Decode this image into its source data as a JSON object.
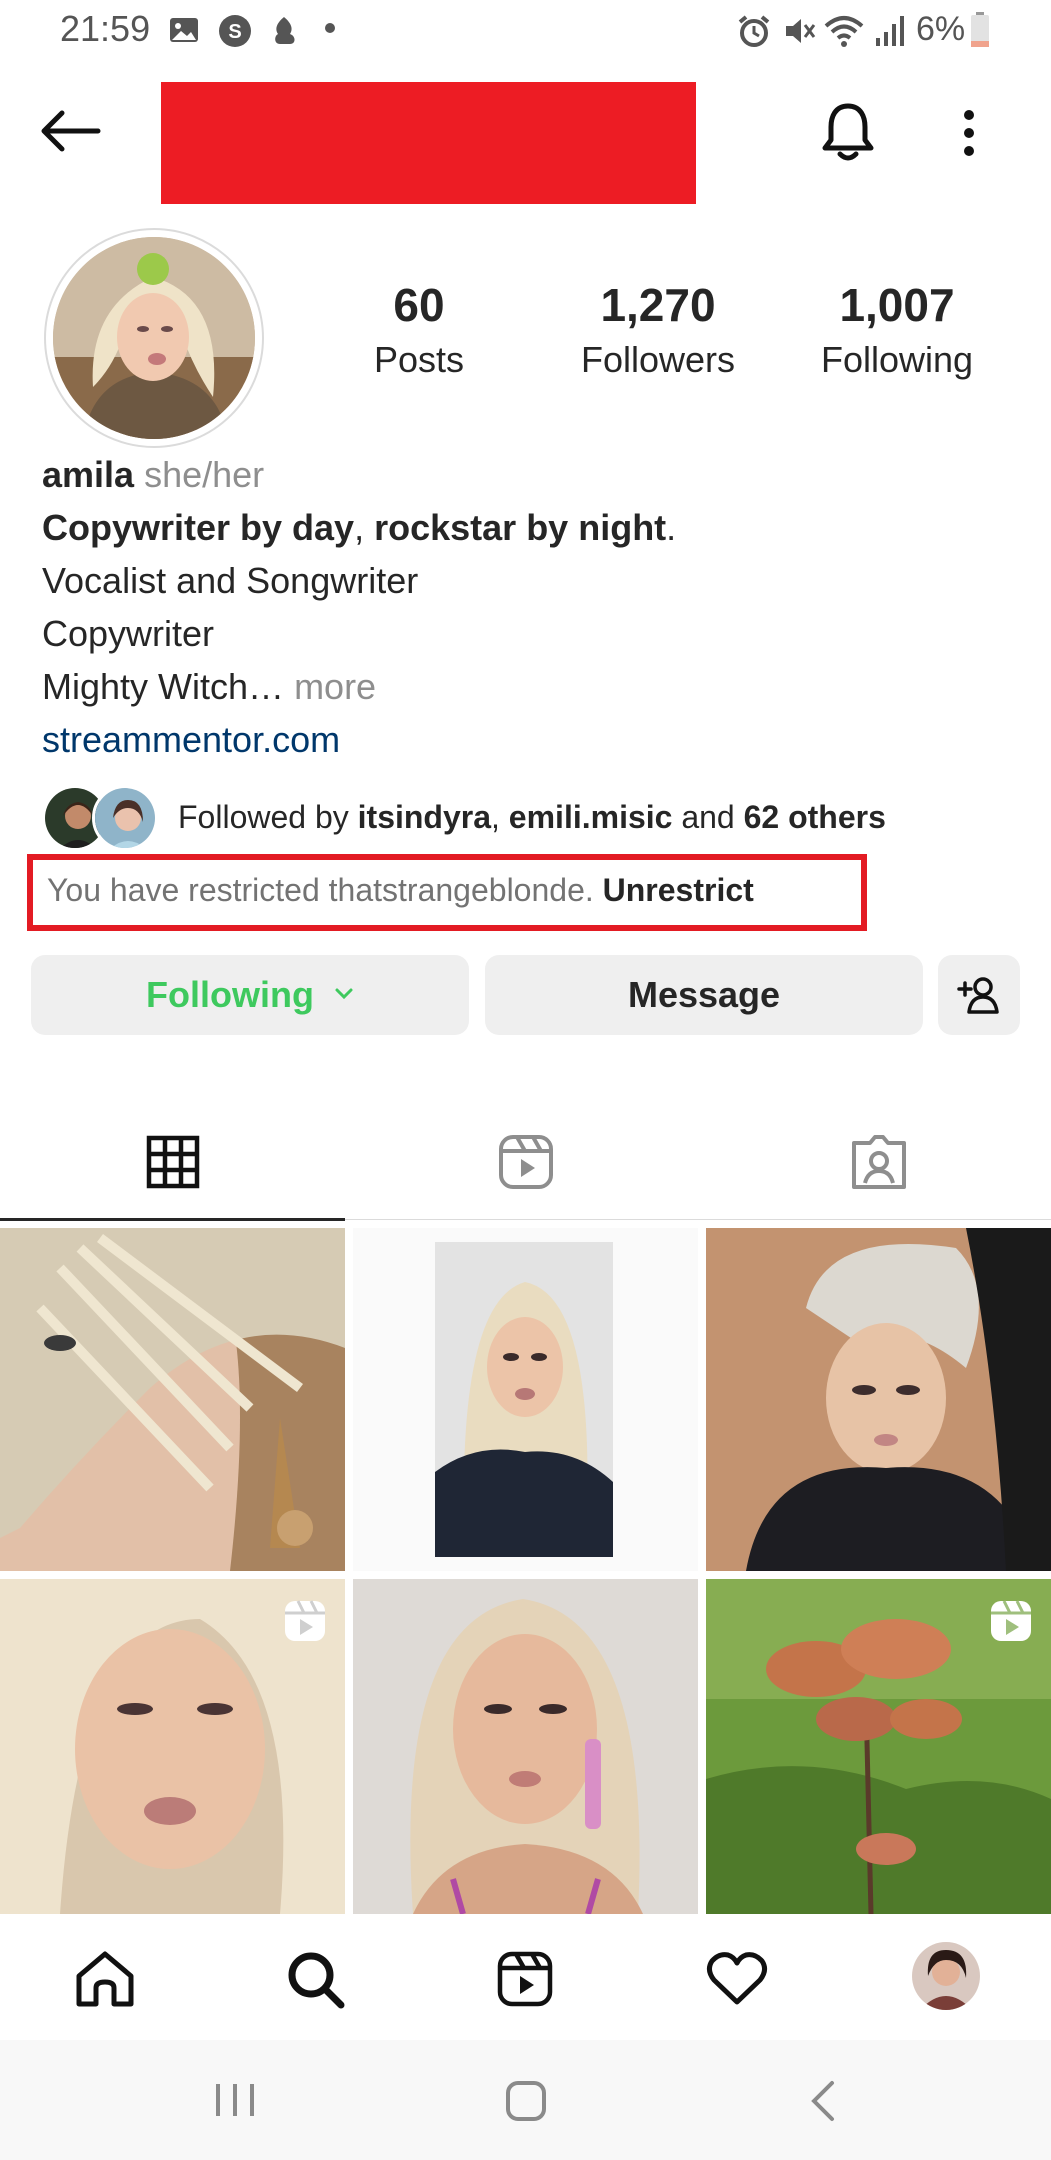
{
  "status_bar": {
    "time": "21:59",
    "battery": "6%",
    "left_icons": [
      "gallery-icon",
      "s-app-icon",
      "notification-icon",
      "dot-icon"
    ],
    "right_icons": [
      "alarm-icon",
      "mute-icon",
      "wifi-icon",
      "signal-icon",
      "battery-icon"
    ]
  },
  "header": {
    "back_icon": "arrow-left-icon",
    "username_redacted": true,
    "bell_icon": "bell-icon",
    "menu_icon": "kebab-menu-icon"
  },
  "profile": {
    "stats": [
      {
        "value": "60",
        "label": "Posts"
      },
      {
        "value": "1,270",
        "label": "Followers"
      },
      {
        "value": "1,007",
        "label": "Following"
      }
    ],
    "name": "amila",
    "pronouns": "she/her",
    "bio_line1_a": "Copywriter by day",
    "bio_line1_sep": ", ",
    "bio_line1_b": "rockstar by night",
    "bio_line1_end": ".",
    "bio_line2": "Vocalist and Songwriter",
    "bio_line3": "Copywriter",
    "bio_line4": "Mighty Witch…",
    "bio_more": "more",
    "link": "streammentor.com"
  },
  "followed_by": {
    "prefix": "Followed by ",
    "user1": "itsindyra",
    "sep": ", ",
    "user2": "emili.misic",
    "and": " and ",
    "others": "62 others"
  },
  "restrict_notice": {
    "text": "You have restricted thatstrangeblonde. ",
    "action": "Unrestrict"
  },
  "actions": {
    "following": "Following",
    "message": "Message"
  },
  "tabs": [
    "grid-icon",
    "reels-icon",
    "tagged-icon"
  ],
  "colors": {
    "accent_green": "#3ec95e",
    "link_blue": "#00376b",
    "highlight_red": "#e31b23"
  }
}
